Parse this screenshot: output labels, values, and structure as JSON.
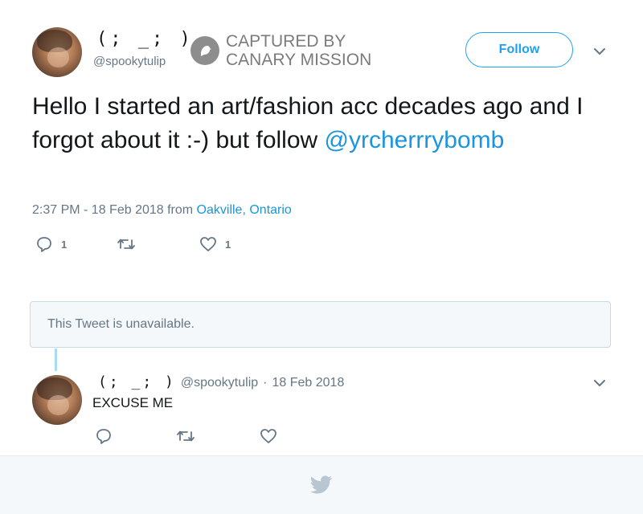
{
  "tweet": {
    "display_name": "(; _; )",
    "handle": "@spookytulip",
    "follow_label": "Follow",
    "text_before": "Hello I started an art/fashion acc decades ago and I forgot about it :-) but follow ",
    "mention": "@yrcherrrybomb",
    "timestamp": "2:37 PM - 18 Feb 2018 from ",
    "location": "Oakville, Ontario",
    "actions": {
      "reply_count": "1",
      "retweet_count": "",
      "like_count": "1"
    }
  },
  "watermark": {
    "line1": "CAPTURED BY",
    "line2": "CANARY MISSION"
  },
  "quoted": {
    "unavailable_text": "This Tweet is unavailable."
  },
  "reply": {
    "display_name": "(; _; )",
    "handle": "@spookytulip",
    "separator": "·",
    "date": "18 Feb 2018",
    "text": "EXCUSE ME"
  },
  "icons": {
    "reply": "reply-icon",
    "retweet": "retweet-icon",
    "like": "heart-icon",
    "caret": "chevron-down-icon",
    "footer": "twitter-bird-icon",
    "watermark": "canary-logo"
  },
  "colors": {
    "accent": "#1da1f2",
    "link": "#1b95e0",
    "muted": "#657786",
    "text": "#14171a"
  }
}
